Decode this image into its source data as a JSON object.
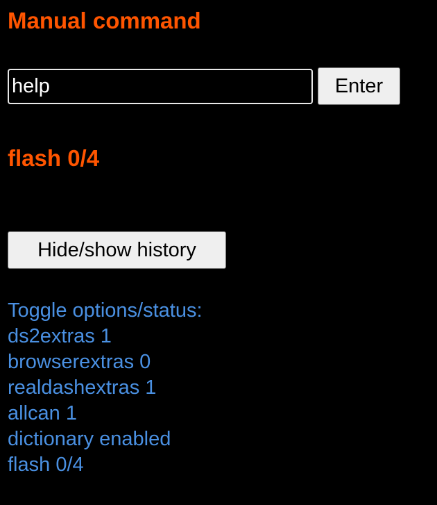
{
  "colors": {
    "background": "#000000",
    "heading": "#ff5500",
    "options_text": "#4a90e2"
  },
  "manual_command": {
    "title": "Manual command",
    "input_value": "help",
    "enter_label": "Enter"
  },
  "flash_status": "flash 0/4",
  "history_button_label": "Hide/show history",
  "toggle_options": {
    "header": "Toggle options/status:",
    "items": [
      "ds2extras 1",
      "browserextras 0",
      "realdashextras 1",
      "allcan 1",
      "dictionary enabled",
      "flash 0/4"
    ]
  }
}
